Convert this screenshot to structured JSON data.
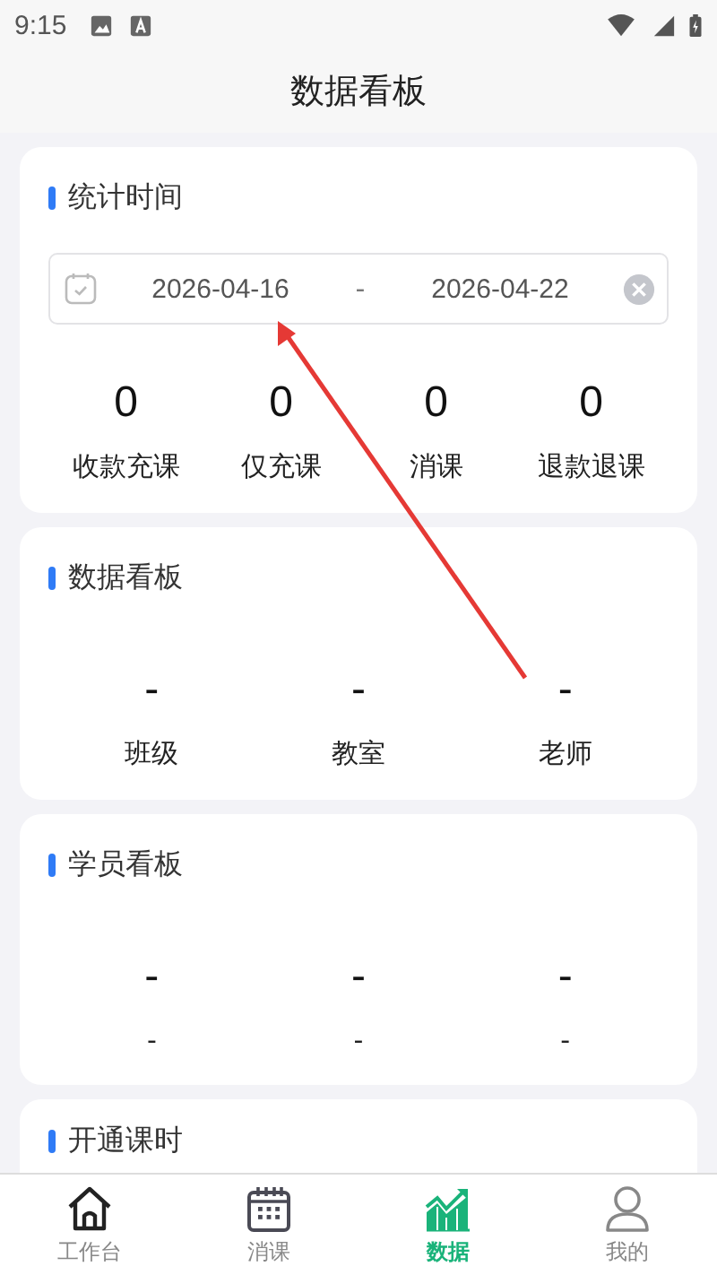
{
  "status_bar": {
    "time": "9:15"
  },
  "header": {
    "title": "数据看板"
  },
  "sections": [
    {
      "kind": "date_stats",
      "title": "统计时间",
      "date_range": {
        "start": "2026-04-16",
        "separator": "-",
        "end": "2026-04-22"
      },
      "stats": [
        {
          "value": "0",
          "label": "收款充课"
        },
        {
          "value": "0",
          "label": "仅充课"
        },
        {
          "value": "0",
          "label": "消课"
        },
        {
          "value": "0",
          "label": "退款退课"
        }
      ]
    },
    {
      "kind": "stats",
      "title": "数据看板",
      "stats": [
        {
          "value": "-",
          "label": "班级"
        },
        {
          "value": "-",
          "label": "教室"
        },
        {
          "value": "-",
          "label": "老师"
        }
      ]
    },
    {
      "kind": "stats",
      "title": "学员看板",
      "stats": [
        {
          "value": "-",
          "label": "-"
        },
        {
          "value": "-",
          "label": "-"
        },
        {
          "value": "-",
          "label": "-"
        }
      ]
    },
    {
      "kind": "title_only",
      "title": "开通课时"
    }
  ],
  "tab_bar": [
    {
      "label": "工作台",
      "selected": false
    },
    {
      "label": "消课",
      "selected": false
    },
    {
      "label": "数据",
      "selected": true
    },
    {
      "label": "我的",
      "selected": false
    }
  ]
}
